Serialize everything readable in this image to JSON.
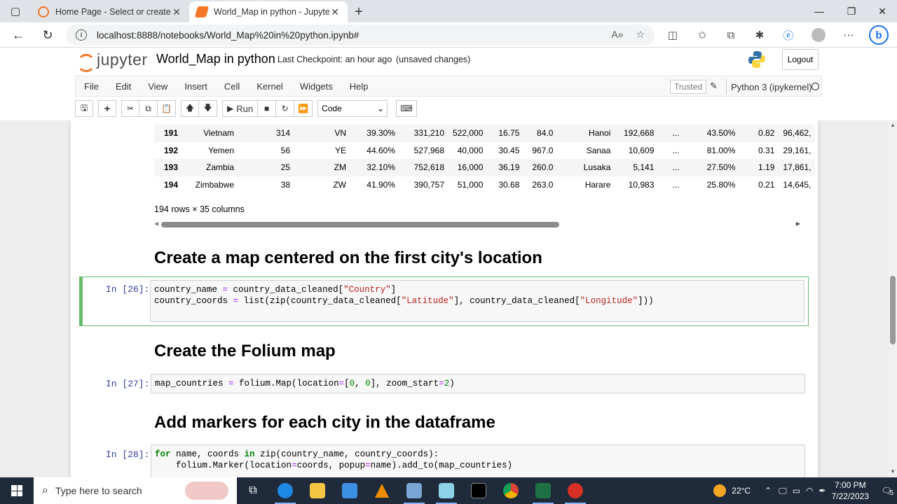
{
  "browser": {
    "tabs": [
      {
        "title": "Home Page - Select or create a n",
        "favicon_color": "#f37726",
        "active": false
      },
      {
        "title": "World_Map in python - Jupyter N",
        "favicon_color": "#f37726",
        "active": true
      }
    ],
    "url": "localhost:8888/notebooks/World_Map%20in%20python.ipynb#"
  },
  "jupyter": {
    "logo_text": "jupyter",
    "notebook_name": "World_Map in python",
    "checkpoint": "Last Checkpoint: an hour ago",
    "unsaved": "(unsaved changes)",
    "logout_label": "Logout",
    "menu": [
      "File",
      "Edit",
      "View",
      "Insert",
      "Cell",
      "Kernel",
      "Widgets",
      "Help"
    ],
    "trusted_label": "Trusted",
    "kernel_name": "Python 3 (ipykernel)",
    "run_label": "Run",
    "cell_type": "Code"
  },
  "dataframe": {
    "rows": [
      [
        "191",
        "Vietnam",
        "314",
        "VN",
        "39.30%",
        "331,210",
        "522,000",
        "16.75",
        "84.0",
        "Hanoi",
        "192,668",
        "...",
        "43.50%",
        "0.82",
        "96,462,"
      ],
      [
        "192",
        "Yemen",
        "56",
        "YE",
        "44.60%",
        "527,968",
        "40,000",
        "30.45",
        "967.0",
        "Sanaa",
        "10,609",
        "...",
        "81.00%",
        "0.31",
        "29,161,"
      ],
      [
        "193",
        "Zambia",
        "25",
        "ZM",
        "32.10%",
        "752,618",
        "16,000",
        "36.19",
        "260.0",
        "Lusaka",
        "5,141",
        "...",
        "27.50%",
        "1.19",
        "17,861,"
      ],
      [
        "194",
        "Zimbabwe",
        "38",
        "ZW",
        "41.90%",
        "390,757",
        "51,000",
        "30.68",
        "263.0",
        "Harare",
        "10,983",
        "...",
        "25.80%",
        "0.21",
        "14,645,"
      ]
    ],
    "size_label": "194 rows × 35 columns"
  },
  "headings": {
    "h1": "Create a map centered on the first city's location",
    "h2": "Create the Folium map",
    "h3": "Add markers for each city in the dataframe"
  },
  "cells": {
    "c26_prompt": "In [26]:",
    "c27_prompt": "In [27]:",
    "c28_prompt": "In [28]:"
  },
  "taskbar": {
    "search_placeholder": "Type here to search",
    "weather": "22°C",
    "time": "7:00 PM",
    "date": "7/22/2023",
    "notifications": "5"
  }
}
